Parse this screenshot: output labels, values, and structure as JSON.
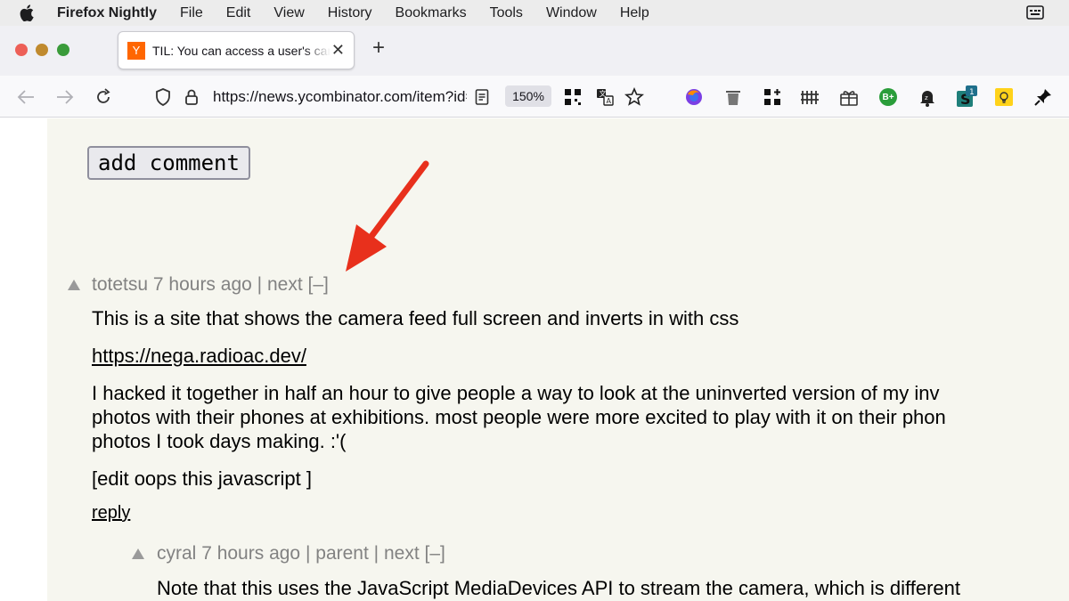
{
  "menubar": {
    "app_name": "Firefox Nightly",
    "items": [
      "File",
      "Edit",
      "View",
      "History",
      "Bookmarks",
      "Tools",
      "Window",
      "Help"
    ]
  },
  "tab": {
    "title": "TIL: You can access a user's camera",
    "favicon_letter": "Y"
  },
  "toolbar": {
    "url": "https://news.ycombinator.com/item?id=",
    "zoom": "150%",
    "extension_badge_count": "1",
    "grade_badge": "B+"
  },
  "page": {
    "add_comment_label": "add comment",
    "comment1": {
      "user": "totetsu",
      "age": "7 hours ago",
      "sep": "|",
      "next": "next",
      "collapse": "[–]",
      "line1": "This is a site that shows the camera feed full screen and inverts in with css",
      "link": "https://nega.radioac.dev/",
      "line3a": "I hacked it together in half an hour to give people a way to look at the uninverted version of my inv",
      "line3b": "photos with their phones at exhibitions. most people were more excited to play with it on their phon",
      "line3c": "photos I took days making. :'(",
      "line4": "[edit oops this javascript ]",
      "reply": "reply"
    },
    "comment2": {
      "user": "cyral",
      "age": "7 hours ago",
      "sep": "|",
      "parent": "parent",
      "next": "next",
      "collapse": "[–]",
      "line1": "Note that this uses the JavaScript MediaDevices API to stream the camera, which is different"
    }
  },
  "colors": {
    "hn_background": "#f6f6ef",
    "meta_grey": "#828282",
    "annotation_arrow": "#e8301c"
  }
}
